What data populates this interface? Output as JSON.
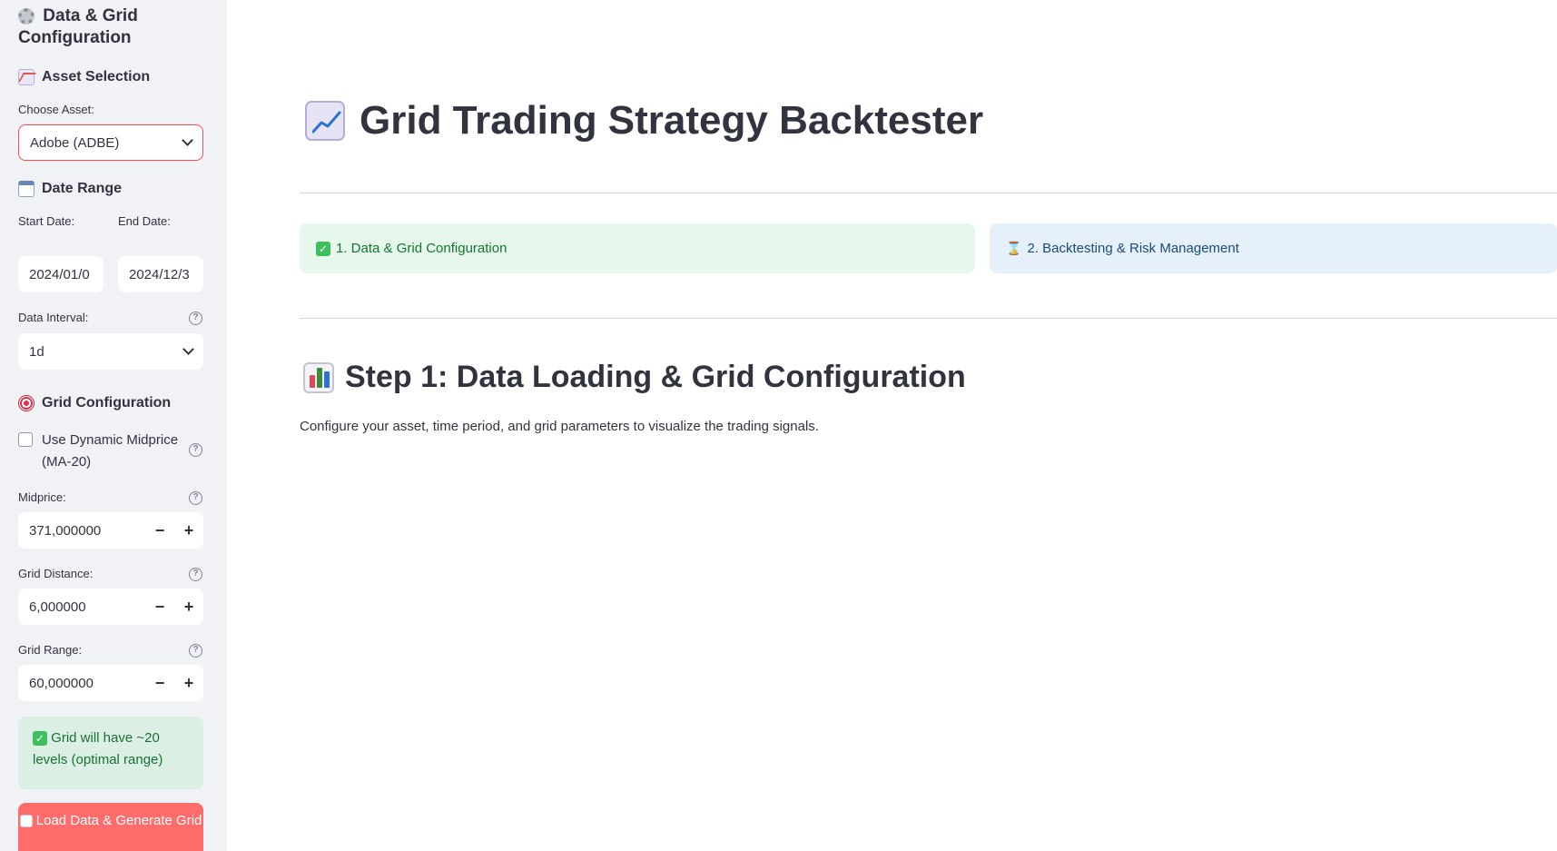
{
  "sidebar": {
    "title": "Data & Grid Configuration",
    "asset_section": {
      "heading": "Asset Selection",
      "choose_label": "Choose Asset:",
      "selected_asset": "Adobe (ADBE)"
    },
    "date_section": {
      "heading": "Date Range",
      "start_label": "Start Date:",
      "start_value": "2024/01/0",
      "end_label": "End Date:",
      "end_value": "2024/12/3",
      "interval_label": "Data Interval:",
      "interval_value": "1d"
    },
    "grid_section": {
      "heading": "Grid Configuration",
      "dynamic_midprice_label": "Use Dynamic Midprice (MA-20)",
      "dynamic_midprice_checked": false,
      "midprice_label": "Midprice:",
      "midprice_value": "371,000000",
      "grid_distance_label": "Grid Distance:",
      "grid_distance_value": "6,000000",
      "grid_range_label": "Grid Range:",
      "grid_range_value": "60,000000",
      "minus": "−",
      "plus": "+"
    },
    "info_message": "Grid will have ~20 levels (optimal range)",
    "load_button": "Load Data & Generate Grid"
  },
  "main": {
    "title": "Grid Trading Strategy Backtester",
    "steps": [
      {
        "label": "1. Data & Grid Configuration",
        "status": "done"
      },
      {
        "label": "2. Backtesting & Risk Management",
        "status": "pending"
      }
    ],
    "step_title": "Step 1: Data Loading & Grid Configuration",
    "step_description": "Configure your asset, time period, and grid parameters to visualize the trading signals."
  },
  "colors": {
    "accent": "#ff4b4b",
    "button": "#ff6c6c",
    "success_bg": "#dcefe4",
    "success_text": "#177233",
    "info_bg": "#e5f0fb",
    "sidebar_bg": "#f0f2f6"
  },
  "icons": {
    "title": "gear-icon",
    "asset": "chart-increasing-icon",
    "date": "calendar-icon",
    "grid": "target-icon",
    "done": "check-icon",
    "pending": "hourglass-icon",
    "step": "bar-chart-icon"
  }
}
